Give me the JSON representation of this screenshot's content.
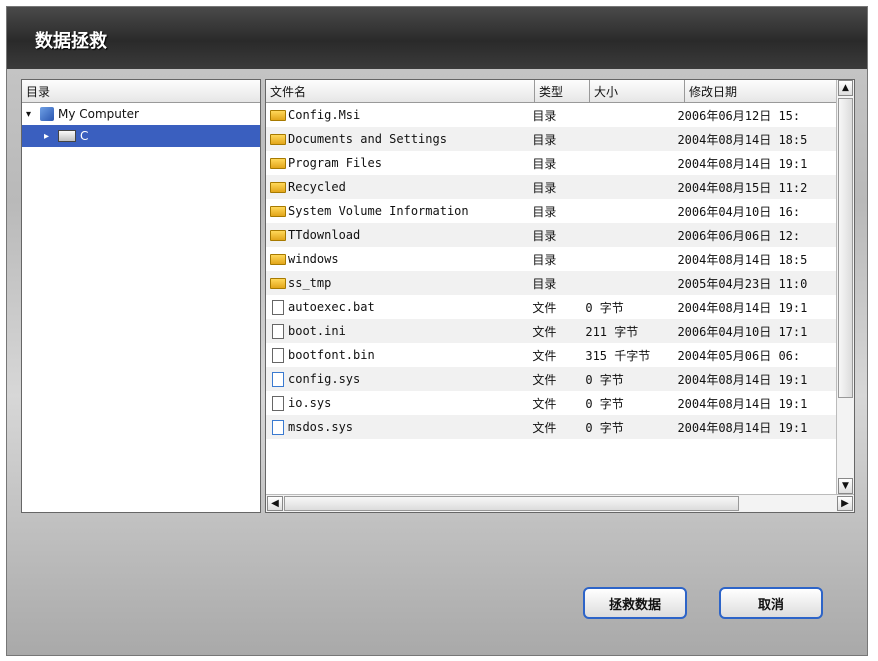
{
  "window": {
    "title": "数据拯救"
  },
  "tree": {
    "header": "目录",
    "items": [
      {
        "label": "My Computer",
        "arrow": "▾"
      },
      {
        "label": "C",
        "arrow": "▸"
      }
    ]
  },
  "files": {
    "columns": [
      "文件名",
      "类型",
      "大小",
      "修改日期"
    ],
    "rows": [
      {
        "name": "Config.Msi",
        "type": "目录",
        "size": "",
        "date": "2006年06月12日 15:",
        "icon": "folder"
      },
      {
        "name": "Documents and Settings",
        "type": "目录",
        "size": "",
        "date": "2004年08月14日 18:5",
        "icon": "folder"
      },
      {
        "name": "Program Files",
        "type": "目录",
        "size": "",
        "date": "2004年08月14日 19:1",
        "icon": "folder"
      },
      {
        "name": "Recycled",
        "type": "目录",
        "size": "",
        "date": "2004年08月15日 11:2",
        "icon": "folder"
      },
      {
        "name": "System Volume Information",
        "type": "目录",
        "size": "",
        "date": "2006年04月10日 16:",
        "icon": "folder"
      },
      {
        "name": "TTdownload",
        "type": "目录",
        "size": "",
        "date": "2006年06月06日 12:",
        "icon": "folder"
      },
      {
        "name": "windows",
        "type": "目录",
        "size": "",
        "date": "2004年08月14日 18:5",
        "icon": "folder"
      },
      {
        "name": "ss_tmp",
        "type": "目录",
        "size": "",
        "date": "2005年04月23日 11:0",
        "icon": "folder"
      },
      {
        "name": "autoexec.bat",
        "type": "文件",
        "size": "0 字节",
        "date": "2004年08月14日 19:1",
        "icon": "file"
      },
      {
        "name": "boot.ini",
        "type": "文件",
        "size": "211 字节",
        "date": "2006年04月10日 17:1",
        "icon": "file"
      },
      {
        "name": "bootfont.bin",
        "type": "文件",
        "size": "315 千字节",
        "date": "2004年05月06日 06:",
        "icon": "file"
      },
      {
        "name": "config.sys",
        "type": "文件",
        "size": "0 字节",
        "date": "2004年08月14日 19:1",
        "icon": "file-blue"
      },
      {
        "name": "io.sys",
        "type": "文件",
        "size": "0 字节",
        "date": "2004年08月14日 19:1",
        "icon": "file"
      },
      {
        "name": "msdos.sys",
        "type": "文件",
        "size": "0 字节",
        "date": "2004年08月14日 19:1",
        "icon": "file-blue"
      }
    ]
  },
  "buttons": {
    "recover": "拯救数据",
    "cancel": "取消"
  }
}
